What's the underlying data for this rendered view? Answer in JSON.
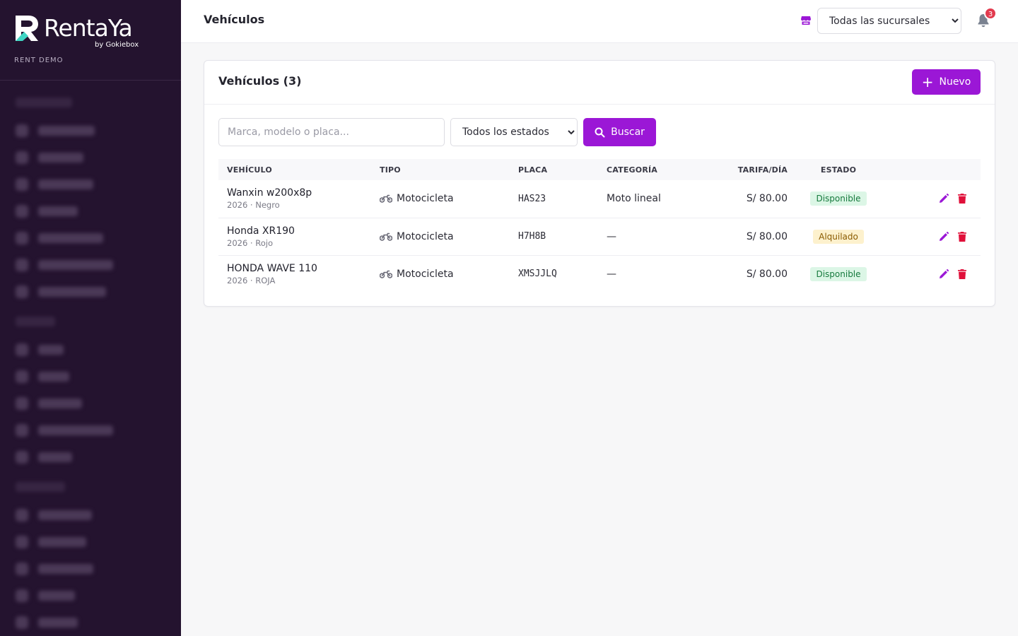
{
  "brand": {
    "name": "RentaYa",
    "by": "by Gokiebox",
    "subtitle": "RENT DEMO"
  },
  "header": {
    "title": "Vehículos",
    "branch_select": "Todas las sucursales",
    "notifications_count": "3"
  },
  "colors": {
    "accent": "#9b17d6",
    "sidebar": "#24132f",
    "danger": "#e0103a"
  },
  "card": {
    "title": "Vehículos (3)",
    "new_button": "Nuevo"
  },
  "filters": {
    "search_placeholder": "Marca, modelo o placa...",
    "status_select": "Todos los estados",
    "search_button": "Buscar"
  },
  "table": {
    "columns": [
      "VEHÍCULO",
      "TIPO",
      "PLACA",
      "CATEGORÍA",
      "TARIFA/DÍA",
      "ESTADO"
    ],
    "rows": [
      {
        "name": "Wanxin w200x8p",
        "sub": "2026 · Negro",
        "type": "Motocicleta",
        "plate": "HAS23",
        "category": "Moto lineal",
        "rate": "S/ 80.00",
        "status": "Disponible"
      },
      {
        "name": "Honda XR190",
        "sub": "2026 · Rojo",
        "type": "Motocicleta",
        "plate": "H7H8B",
        "category": "—",
        "rate": "S/ 80.00",
        "status": "Alquilado"
      },
      {
        "name": "HONDA WAVE 110",
        "sub": "2026 · ROJA",
        "type": "Motocicleta",
        "plate": "XMSJJLQ",
        "category": "—",
        "rate": "S/ 80.00",
        "status": "Disponible"
      }
    ]
  }
}
